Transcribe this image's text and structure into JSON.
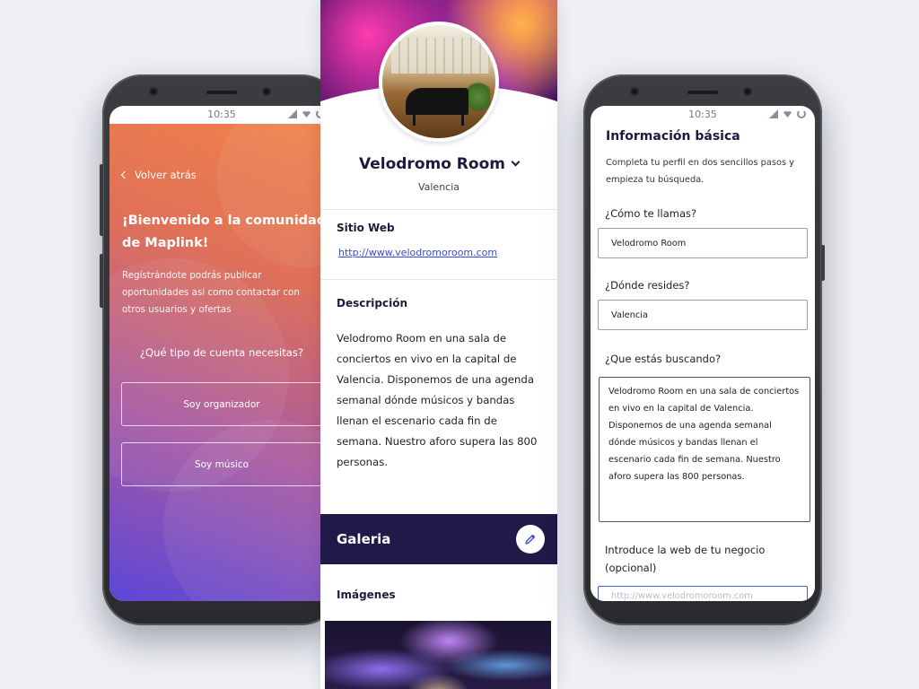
{
  "status_time": "10:35",
  "left_phone": {
    "back_label": "Volver atrás",
    "welcome_title": "¡Bienvenido a la comunidad de Maplink!",
    "welcome_text": "Regístrándote podrás publicar oportunidades asi como contactar con otros usuarios y ofertas",
    "account_question": "¿Qué tipo de cuenta necesitas?",
    "option_organizer": "Soy organizador",
    "option_musician": "Soy músico",
    "gradient_colors": [
      "#f0824a",
      "#5c47d6"
    ]
  },
  "profile": {
    "name": "Velodromo Room",
    "city": "Valencia",
    "website_label": "Sitio Web",
    "website_url": "http://www.velodromoroom.com",
    "description_label": "Descripción",
    "description": "Velodromo Room en una sala de conciertos en vivo en la capital de Valencia. Disponemos de una agenda semanal dónde músicos y bandas llenan el escenario cada fin de semana. Nuestro aforo supera las 800 personas.",
    "gallery_title": "Galeria",
    "images_label": "Imágenes",
    "accent_dark": "#1f1a47"
  },
  "form": {
    "title": "Información básica",
    "subtitle": "Completa tu perfil en dos sencillos  pasos y empieza tu búsqueda.",
    "name_label": "¿Cómo te llamas?",
    "name_value": "Velodromo Room",
    "residence_label": "¿Dónde resides?",
    "residence_value": "Valencia",
    "looking_label": "¿Que estás buscando?",
    "looking_value": "Velodromo Room en una sala de conciertos en vivo en la capital de Valencia. Disponemos de una agenda semanal dónde músicos y bandas llenan el escenario cada fin de semana. Nuestro aforo supera las 800 personas.",
    "web_label": "Introduce la web de tu negocio (opcional)",
    "web_value": "http://www.velodromoroom.com"
  }
}
